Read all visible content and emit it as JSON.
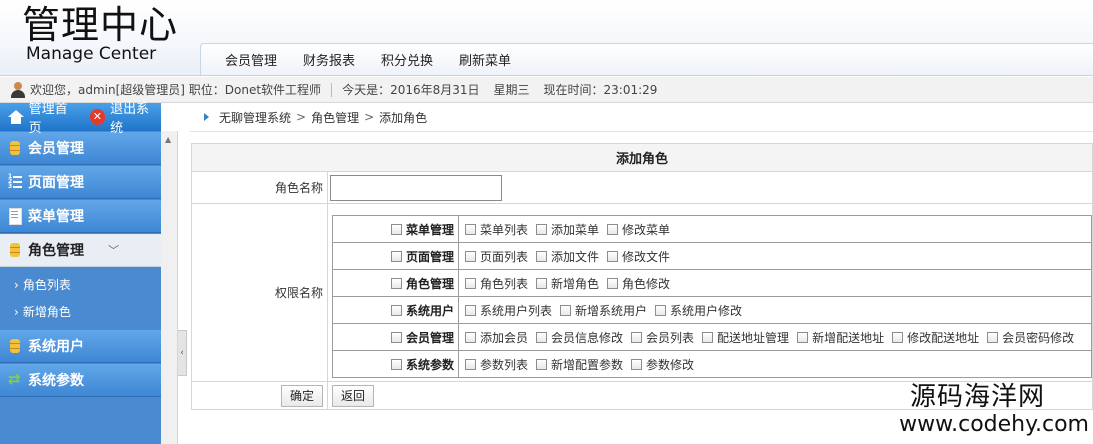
{
  "header": {
    "logo_cn": "管理中心",
    "logo_en": "Manage Center",
    "nav": [
      "会员管理",
      "财务报表",
      "积分兑换",
      "刷新菜单"
    ]
  },
  "infobar": {
    "welcome": "欢迎您，admin[超级管理员] 职位：Donet软件工程师",
    "today": "今天是：2016年8月31日",
    "weekday": "星期三",
    "time": "现在时间：23:01:29"
  },
  "sidebar": {
    "home": "管理首页",
    "exit": "退出系统",
    "menus": [
      "会员管理",
      "页面管理",
      "菜单管理",
      "角色管理",
      "系统用户",
      "系统参数"
    ],
    "submenu": [
      "角色列表",
      "新增角色"
    ]
  },
  "breadcrumb": [
    "无聊管理系统",
    "角色管理",
    "添加角色"
  ],
  "form": {
    "title": "添加角色",
    "name_label": "角色名称",
    "name_value": "",
    "perm_label": "权限名称",
    "groups": [
      {
        "name": "菜单管理",
        "items": [
          "菜单列表",
          "添加菜单",
          "修改菜单"
        ]
      },
      {
        "name": "页面管理",
        "items": [
          "页面列表",
          "添加文件",
          "修改文件"
        ]
      },
      {
        "name": "角色管理",
        "items": [
          "角色列表",
          "新增角色",
          "角色修改"
        ]
      },
      {
        "name": "系统用户",
        "items": [
          "系统用户列表",
          "新增系统用户",
          "系统用户修改"
        ]
      },
      {
        "name": "会员管理",
        "items": [
          "添加会员",
          "会员信息修改",
          "会员列表",
          "配送地址管理",
          "新增配送地址",
          "修改配送地址",
          "会员密码修改"
        ]
      },
      {
        "name": "系统参数",
        "items": [
          "参数列表",
          "新增配置参数",
          "参数修改"
        ]
      }
    ],
    "ok": "确定",
    "back": "返回"
  },
  "watermark": {
    "cn": "源码海洋网",
    "url": "www.codehy.com"
  }
}
